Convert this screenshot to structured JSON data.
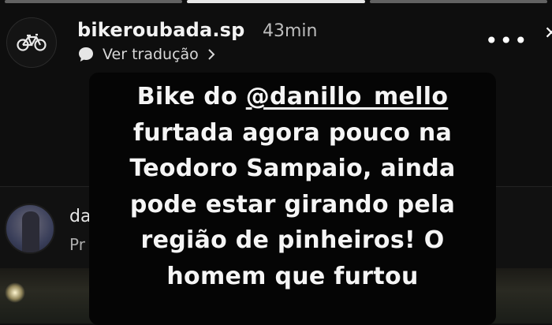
{
  "story": {
    "username": "bikeroubada.sp",
    "time_ago": "43min",
    "translate_label": "Ver tradução",
    "avatar_icon": "bicycle-icon",
    "progress_segments": 3,
    "active_segment": 1
  },
  "caption": {
    "line1_prefix": "Bike do ",
    "mention": "@danillo_mello",
    "line2": "furtada agora pouco na",
    "line3": "Teodoro Sampaio, ainda",
    "line4": "pode estar girando pela",
    "line5": "região de pinheiros! O",
    "line6": "homem que furtou"
  },
  "background_post": {
    "name_fragment": "da",
    "sub_fragment": "Pr"
  },
  "icons": {
    "more": "more-options-icon",
    "translate": "chat-bubble-icon",
    "chevron": "chevron-right-icon"
  },
  "colors": {
    "background": "#0e0e0e",
    "caption_bg": "#050505",
    "text": "#f5f5f5",
    "muted": "#bdbdbd"
  }
}
